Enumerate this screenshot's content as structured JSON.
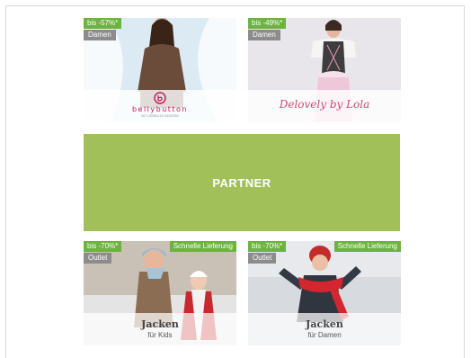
{
  "tiles": [
    {
      "discount": "bis -57%*",
      "category": "Damen",
      "brand_text": "bellybutton",
      "brand_tagline": "MIT LIEBEN ZU KINDERN"
    },
    {
      "discount": "bis -49%*",
      "category": "Damen",
      "brand_text": "Delovely by Lola"
    }
  ],
  "partner": {
    "label": "PARTNER"
  },
  "bottom_tiles": [
    {
      "discount": "bis -70%*",
      "category": "Outlet",
      "shipping": "Schnelle Lieferung",
      "title": "Jacken",
      "subtitle": "für Kids"
    },
    {
      "discount": "bis -70%*",
      "category": "Outlet",
      "shipping": "Schnelle Lieferung",
      "title": "Jacken",
      "subtitle": "für Damen"
    }
  ],
  "colors": {
    "badge_green": "#6db33f",
    "badge_gray": "#8c8c8c",
    "partner_green": "#a1c05a",
    "brand_pink": "#c2185b"
  }
}
